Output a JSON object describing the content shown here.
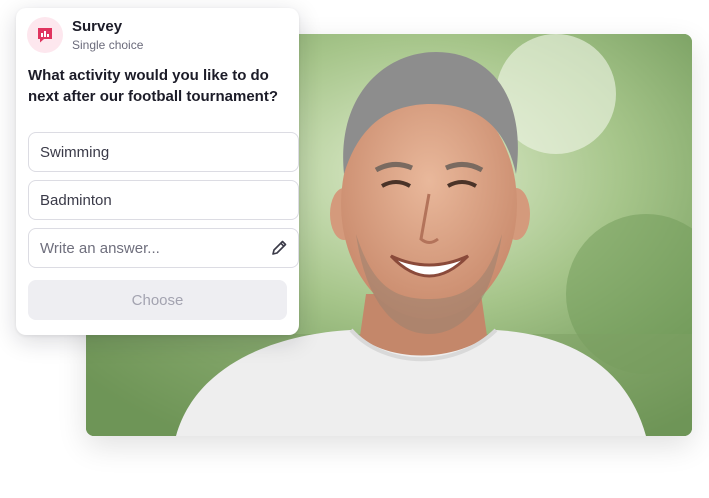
{
  "survey": {
    "title": "Survey",
    "subtitle": "Single choice",
    "icon": "bar-chart-chat-icon",
    "question": "What activity would you like to do next after our football tournament?",
    "options": [
      "Swimming",
      "Badminton"
    ],
    "answer_placeholder": "Write an answer...",
    "choose_label": "Choose",
    "colors": {
      "accent": "#e0345f",
      "accent_bg": "#fde7ee",
      "button_bg": "#eeeef2",
      "button_text": "#a3a3b0"
    }
  },
  "photo": {
    "subject": "smiling man portrait"
  }
}
